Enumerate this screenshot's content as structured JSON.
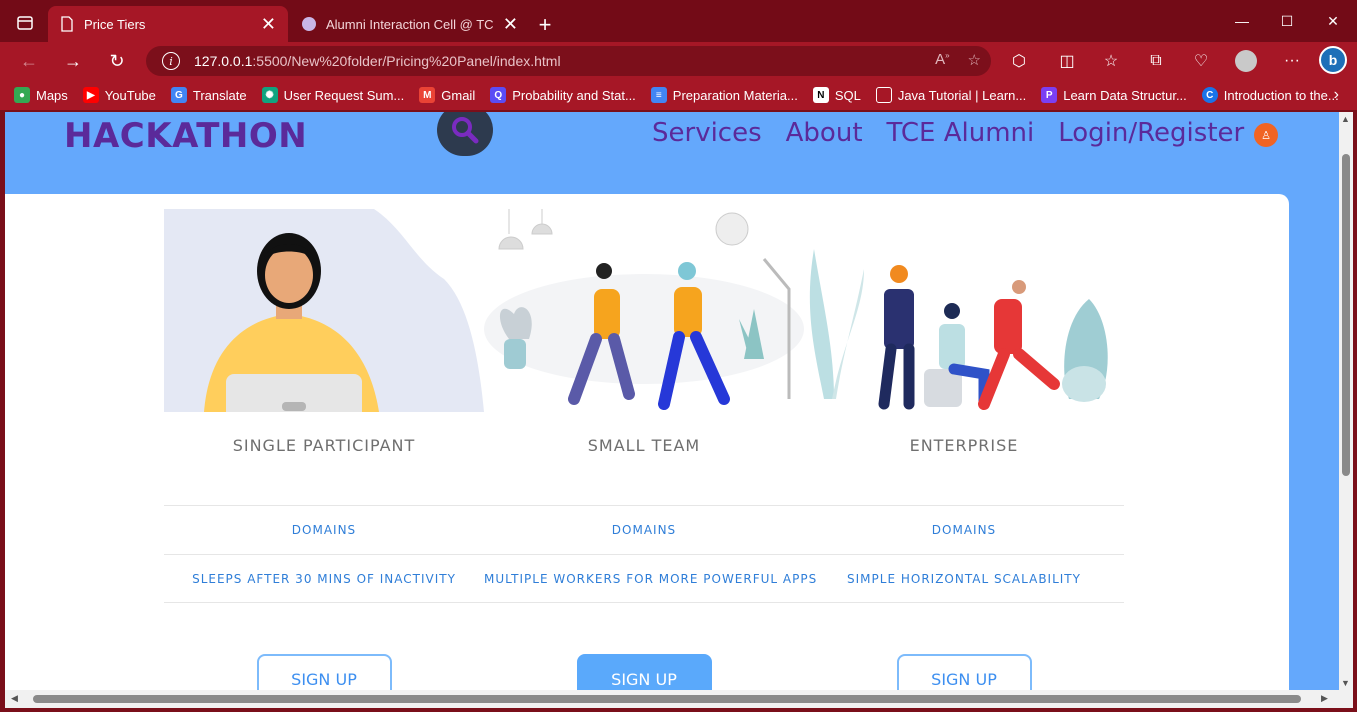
{
  "browser": {
    "tabs": [
      {
        "label": "Price Tiers",
        "active": true
      },
      {
        "label": "Alumni Interaction Cell @ TCE | T",
        "active": false
      }
    ],
    "address": {
      "host": "127.0.0.1",
      "path": ":5500/New%20folder/Pricing%20Panel/index.html"
    },
    "bookmarks": [
      {
        "label": "Maps",
        "icon": "maps-icon",
        "color": "#34a853"
      },
      {
        "label": "YouTube",
        "icon": "youtube-icon",
        "color": "#ff0000"
      },
      {
        "label": "Translate",
        "icon": "translate-icon",
        "color": "#4285f4"
      },
      {
        "label": "User Request Sum...",
        "icon": "openai-icon",
        "color": "#10a37f"
      },
      {
        "label": "Gmail",
        "icon": "gmail-icon",
        "color": "#ea4335"
      },
      {
        "label": "Probability and Stat...",
        "icon": "q-icon",
        "color": "#5b4cf5"
      },
      {
        "label": "Preparation Materia...",
        "icon": "docs-icon",
        "color": "#4285f4"
      },
      {
        "label": "SQL",
        "icon": "notion-icon",
        "color": "#000000"
      },
      {
        "label": "Java Tutorial | Learn...",
        "icon": "page-icon",
        "color": "#ffffff"
      },
      {
        "label": "Learn Data Structur...",
        "icon": "learn-icon",
        "color": "#7b3ff2"
      },
      {
        "label": "Introduction to the...",
        "icon": "c-icon",
        "color": "#1a73e8"
      }
    ]
  },
  "site": {
    "logo": "HACKATHON",
    "nav": [
      "Services",
      "About",
      "TCE Alumni",
      "Login/Register"
    ]
  },
  "tiers": [
    {
      "title": "SINGLE PARTICIPANT",
      "feature1": "DOMAINS",
      "feature2": "SLEEPS AFTER 30 MINS OF INACTIVITY",
      "cta": "SIGN UP",
      "highlight": false
    },
    {
      "title": "SMALL TEAM",
      "feature1": "DOMAINS",
      "feature2": "MULTIPLE WORKERS FOR MORE POWERFUL APPS",
      "cta": "SIGN UP",
      "highlight": true
    },
    {
      "title": "ENTERPRISE",
      "feature1": "DOMAINS",
      "feature2": "SIMPLE HORIZONTAL SCALABILITY",
      "cta": "SIGN UP",
      "highlight": false
    }
  ],
  "colors": {
    "brand": "#5b2a9a",
    "page_bg": "#64a8fc",
    "accent": "#3d8ff0",
    "browser_frame": "#a61726"
  }
}
